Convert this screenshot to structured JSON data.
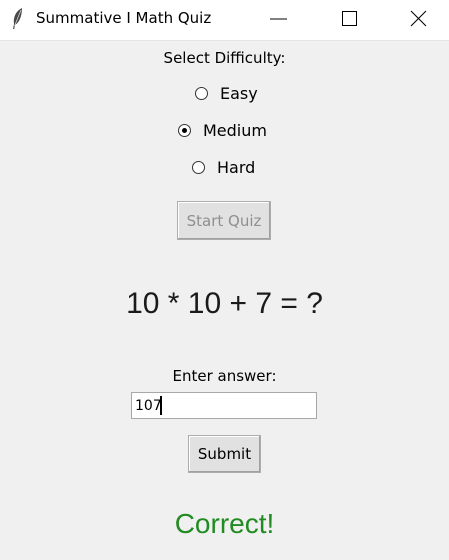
{
  "window": {
    "title": "Summative I Math Quiz",
    "app_icon": "feather-icon",
    "controls": [
      "minimize-icon",
      "maximize-icon",
      "close-icon"
    ]
  },
  "difficulty": {
    "label": "Select Difficulty:",
    "options": [
      {
        "label": "Easy",
        "checked": false
      },
      {
        "label": "Medium",
        "checked": true
      },
      {
        "label": "Hard",
        "checked": false
      }
    ],
    "selected": "Medium"
  },
  "start_button": {
    "label": "Start Quiz",
    "enabled": false
  },
  "question": {
    "text": "10 * 10 + 7 = ?"
  },
  "answer": {
    "label": "Enter answer:",
    "value": "107"
  },
  "submit_button": {
    "label": "Submit"
  },
  "result": {
    "text": "Correct!",
    "color": "#228b22"
  },
  "colors": {
    "background": "#f0f0f0",
    "disabled_text": "#8f8f8f"
  }
}
